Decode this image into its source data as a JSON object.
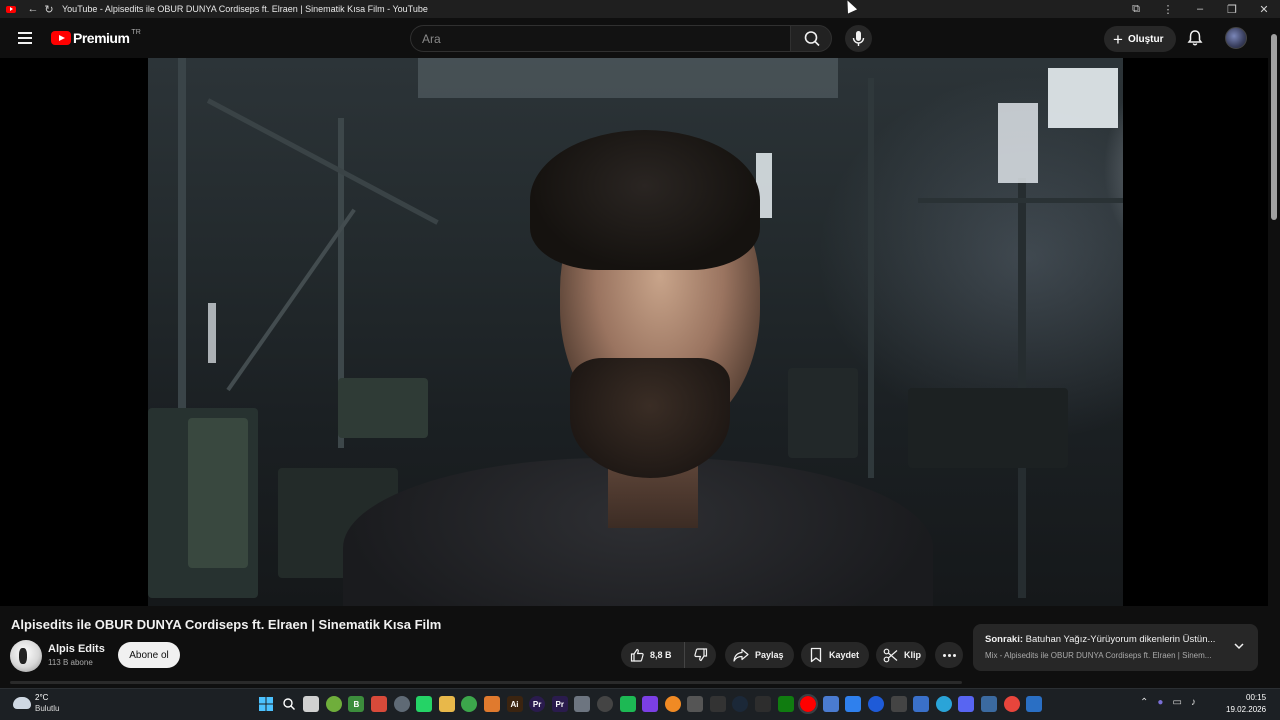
{
  "browser": {
    "tab_title": "YouTube - Alpisedits ile OBUR DUNYA Cordiseps ft. Elraen | Sinematik Kısa Film - YouTube"
  },
  "masthead": {
    "logo_text": "Premium",
    "logo_country": "TR",
    "search_placeholder": "Ara",
    "create_label": "Oluştur"
  },
  "video": {
    "title": "Alpisedits ile OBUR DUNYA Cordiseps ft. Elraen | Sinematik Kısa Film",
    "channel_name": "Alpis Edits",
    "subscribers": "113 B abone",
    "subscribe_label": "Abone ol",
    "likes": "8,8 B",
    "share_label": "Paylaş",
    "save_label": "Kaydet",
    "clip_label": "Klip"
  },
  "up_next": {
    "prefix": "Sonraki:",
    "title": "Batuhan Yağız-Yürüyorum dikenlerin Üstün...",
    "subtitle": "Mix - Alpisedits ile OBUR DUNYA Cordiseps ft. Elraen | Sinem..."
  },
  "taskbar": {
    "weather_temp": "2°C",
    "weather_desc": "Bulutlu",
    "time": "00:15",
    "date": "19.02.2026",
    "apps": [
      {
        "icon": "windows-start-icon",
        "color": "#3a96dd",
        "glyph": ""
      },
      {
        "icon": "search-icon",
        "color": "transparent",
        "glyph": ""
      },
      {
        "icon": "file-explorer-icon",
        "color": "#d0d0d0",
        "glyph": ""
      },
      {
        "icon": "app-green-icon",
        "color": "#6fae3b",
        "glyph": ""
      },
      {
        "icon": "app-b-icon",
        "color": "#3c8d3c",
        "glyph": "B"
      },
      {
        "icon": "app-red-icon",
        "color": "#d84a3a",
        "glyph": ""
      },
      {
        "icon": "app-tool-icon",
        "color": "#5f6a75",
        "glyph": ""
      },
      {
        "icon": "whatsapp-icon",
        "color": "#25d366",
        "glyph": ""
      },
      {
        "icon": "folder-icon",
        "color": "#e8b84a",
        "glyph": ""
      },
      {
        "icon": "app-green2-icon",
        "color": "#3ca64b",
        "glyph": ""
      },
      {
        "icon": "app-orange-icon",
        "color": "#e07a2e",
        "glyph": ""
      },
      {
        "icon": "illustrator-icon",
        "color": "#3b2410",
        "glyph": "Ai"
      },
      {
        "icon": "premiere-icon",
        "color": "#2a1b4d",
        "glyph": "Pr"
      },
      {
        "icon": "premiere2-icon",
        "color": "#2a1b4d",
        "glyph": "Pr"
      },
      {
        "icon": "app-gray-icon",
        "color": "#6d7580",
        "glyph": ""
      },
      {
        "icon": "app-circle-icon",
        "color": "#444",
        "glyph": ""
      },
      {
        "icon": "spotify-icon",
        "color": "#1db954",
        "glyph": ""
      },
      {
        "icon": "app-purple-icon",
        "color": "#7b3fe4",
        "glyph": ""
      },
      {
        "icon": "app-orange2-icon",
        "color": "#f08a24",
        "glyph": ""
      },
      {
        "icon": "app-grid-icon",
        "color": "#555",
        "glyph": ""
      },
      {
        "icon": "obs-icon",
        "color": "#333",
        "glyph": ""
      },
      {
        "icon": "steam-icon",
        "color": "#1b2838",
        "glyph": ""
      },
      {
        "icon": "app-dark-icon",
        "color": "#2d2d2d",
        "glyph": ""
      },
      {
        "icon": "xbox-icon",
        "color": "#107c10",
        "glyph": ""
      },
      {
        "icon": "youtube-icon",
        "color": "#ff0000",
        "glyph": ""
      },
      {
        "icon": "app-multi-icon",
        "color": "#4a7bd0",
        "glyph": ""
      },
      {
        "icon": "app-blue-icon",
        "color": "#2f80ed",
        "glyph": ""
      },
      {
        "icon": "app-blue2-icon",
        "color": "#1e5bd8",
        "glyph": ""
      },
      {
        "icon": "app-box-icon",
        "color": "#444",
        "glyph": ""
      },
      {
        "icon": "app-blue3-icon",
        "color": "#3a70c9",
        "glyph": ""
      },
      {
        "icon": "app-cyan-icon",
        "color": "#2aa4d8",
        "glyph": ""
      },
      {
        "icon": "discord-icon",
        "color": "#5865f2",
        "glyph": ""
      },
      {
        "icon": "app-gear-icon",
        "color": "#3b6aa0",
        "glyph": ""
      },
      {
        "icon": "chrome-icon",
        "color": "#e8453c",
        "glyph": ""
      },
      {
        "icon": "app-check-icon",
        "color": "#2a6fc4",
        "glyph": ""
      }
    ]
  }
}
